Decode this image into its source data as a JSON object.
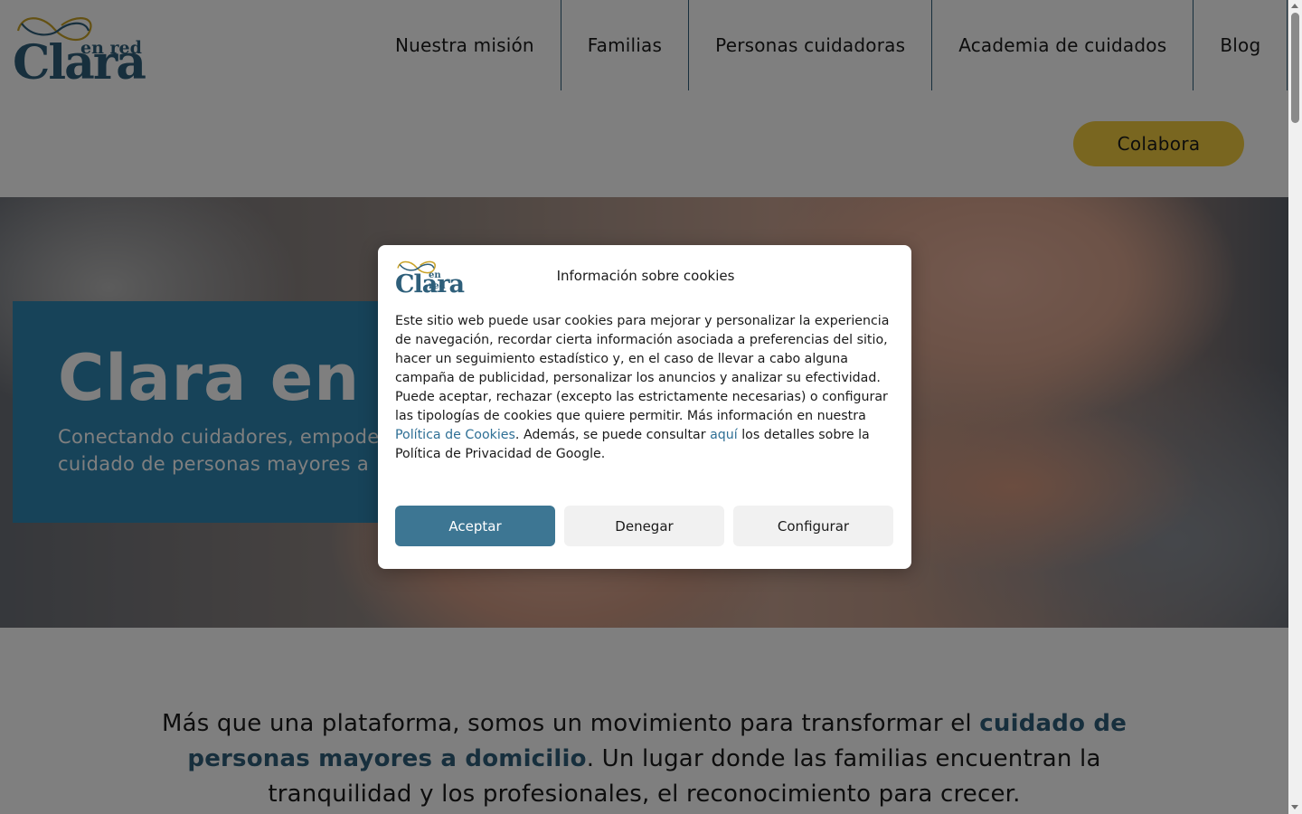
{
  "brand": {
    "wordmark": "Clara",
    "tagline": "en red",
    "colors": {
      "primary": "#2e5f7a",
      "accent": "#f2cd40",
      "gold": "#c9a227"
    }
  },
  "nav": {
    "items": [
      {
        "label": "Nuestra misión"
      },
      {
        "label": "Familias"
      },
      {
        "label": "Personas cuidadoras"
      },
      {
        "label": "Academia de cuidados"
      },
      {
        "label": "Blog"
      }
    ],
    "cta_label": "Colabora"
  },
  "hero": {
    "title": "Clara en",
    "subtitle_line1": "Conectando cuidadores, empode",
    "subtitle_line2": "cuidado de personas mayores a"
  },
  "intro": {
    "part1": "Más que una plataforma, somos un movimiento para transformar el ",
    "highlight": "cuidado de personas mayores a domicilio",
    "part2": ". Un lugar donde las familias encuentran la tranquilidad y los profesionales, el reconocimiento para crecer."
  },
  "cookie_modal": {
    "title": "Información sobre cookies",
    "body_part1": "Este sitio web puede usar cookies para mejorar y personalizar la experiencia de navegación, recordar cierta información asociada a preferencias del sitio, hacer un seguimiento estadístico y, en el caso de llevar a cabo alguna campaña de publicidad, personalizar los anuncios y analizar su efectividad. Puede aceptar, rechazar (excepto las estrictamente necesarias) o configurar las tipologías de cookies que quiere permitir. Más información en nuestra ",
    "link_policy": "Política de Cookies",
    "body_part2": ". Además, se puede consultar ",
    "link_here": "aquí",
    "body_part3": " los detalles sobre la Política de Privacidad de Google.",
    "accept_label": "Aceptar",
    "deny_label": "Denegar",
    "configure_label": "Configurar"
  },
  "icons": {
    "logo_mark": "infinity-ribbon-icon",
    "scroll_up": "scroll-up-arrow-icon",
    "scroll_down": "scroll-down-arrow-icon"
  }
}
